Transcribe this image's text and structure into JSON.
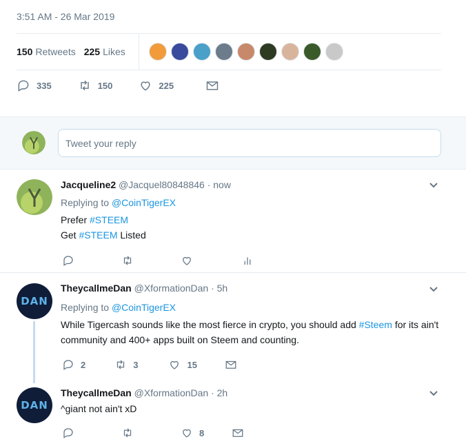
{
  "timestamp": "3:51 AM - 26 Mar 2019",
  "stats": {
    "retweets_count": "150",
    "retweets_label": "Retweets",
    "likes_count": "225",
    "likes_label": "Likes"
  },
  "likers": [
    "#f29b3a",
    "#3a4a9c",
    "#4aa0c8",
    "#6d7c8a",
    "#c8896a",
    "#2e3a22",
    "#d9b49c",
    "#3b5a2a",
    "#c9c9c9"
  ],
  "main_actions": {
    "replies": "335",
    "retweets": "150",
    "likes": "225"
  },
  "reply_box": {
    "placeholder": "Tweet your reply"
  },
  "tweets": [
    {
      "name": "Jacqueline2",
      "handle": "@Jacquel80848846",
      "time": "· now",
      "replying_prefix": "Replying to",
      "replying_to": "@CoinTigerEX",
      "line1_a": "Prefer",
      "line1_tag": "#STEEM",
      "line2_a": "Get",
      "line2_tag": "#STEEM",
      "line2_b": "Listed",
      "replies": "",
      "retweets": "",
      "likes": ""
    },
    {
      "name": "TheycallmeDan",
      "handle": "@XformationDan",
      "time": "· 5h",
      "replying_prefix": "Replying to",
      "replying_to": "@CoinTigerEX",
      "text_a": "While Tigercash sounds like the most fierce in crypto, you should add",
      "text_tag": "#Steem",
      "text_b": "for its ain't community and 400+ apps built on Steem and counting.",
      "replies": "2",
      "retweets": "3",
      "likes": "15",
      "avatar_text": "DAN"
    },
    {
      "name": "TheycallmeDan",
      "handle": "@XformationDan",
      "time": "· 2h",
      "text": "^giant not ain't xD",
      "replies": "",
      "retweets": "",
      "likes": "8",
      "avatar_text": "DAN"
    }
  ]
}
